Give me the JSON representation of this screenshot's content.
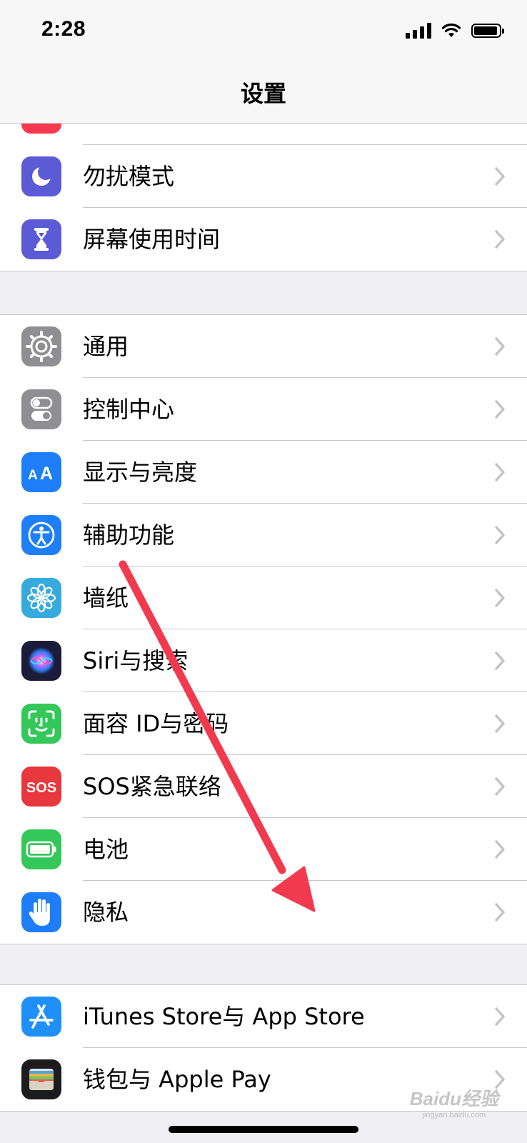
{
  "status_bar": {
    "time": "2:28"
  },
  "nav": {
    "title": "设置"
  },
  "groups": [
    {
      "items": [
        {
          "label": "",
          "icon": "notifications-icon",
          "color": "#f7394e"
        },
        {
          "label": "勿扰模式",
          "icon": "moon-icon",
          "color": "#5b5bd6"
        },
        {
          "label": "屏幕使用时间",
          "icon": "hourglass-icon",
          "color": "#5b5bd6"
        }
      ]
    },
    {
      "items": [
        {
          "label": "通用",
          "icon": "gear-icon",
          "color": "#8e8e93"
        },
        {
          "label": "控制中心",
          "icon": "toggles-icon",
          "color": "#8e8e93"
        },
        {
          "label": "显示与亮度",
          "icon": "text-size-icon",
          "color": "#1e7ef7"
        },
        {
          "label": "辅助功能",
          "icon": "accessibility-icon",
          "color": "#1e7ef7"
        },
        {
          "label": "墙纸",
          "icon": "flower-icon",
          "color": "#36aadc"
        },
        {
          "label": "Siri与搜索",
          "icon": "siri-icon",
          "color": "#1b1b3a"
        },
        {
          "label": "面容 ID与密码",
          "icon": "face-id-icon",
          "color": "#34c759"
        },
        {
          "label": "SOS紧急联络",
          "icon": "sos-icon",
          "color": "#e8383d"
        },
        {
          "label": "电池",
          "icon": "battery-icon",
          "color": "#34c759"
        },
        {
          "label": "隐私",
          "icon": "hand-icon",
          "color": "#1e7ef7"
        }
      ]
    },
    {
      "items": [
        {
          "label": "iTunes Store与 App Store",
          "icon": "app-store-icon",
          "color": "#1e90f7"
        },
        {
          "label": "钱包与 Apple Pay",
          "icon": "wallet-icon",
          "color": "#1c1c1e"
        }
      ]
    }
  ],
  "annotation": {
    "arrow_color": "#f23a4f"
  },
  "watermark": {
    "main": "Baidu经验",
    "sub": "jingyan.baidu.com"
  }
}
